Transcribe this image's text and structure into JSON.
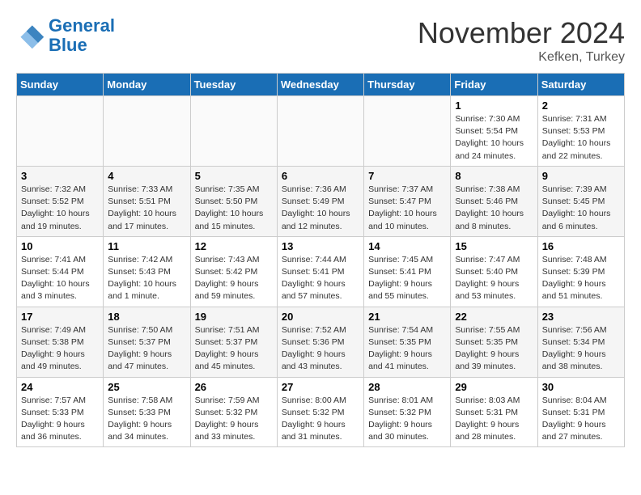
{
  "header": {
    "logo_line1": "General",
    "logo_line2": "Blue",
    "month": "November 2024",
    "location": "Kefken, Turkey"
  },
  "days_of_week": [
    "Sunday",
    "Monday",
    "Tuesday",
    "Wednesday",
    "Thursday",
    "Friday",
    "Saturday"
  ],
  "weeks": [
    [
      {
        "day": "",
        "info": ""
      },
      {
        "day": "",
        "info": ""
      },
      {
        "day": "",
        "info": ""
      },
      {
        "day": "",
        "info": ""
      },
      {
        "day": "",
        "info": ""
      },
      {
        "day": "1",
        "info": "Sunrise: 7:30 AM\nSunset: 5:54 PM\nDaylight: 10 hours and 24 minutes."
      },
      {
        "day": "2",
        "info": "Sunrise: 7:31 AM\nSunset: 5:53 PM\nDaylight: 10 hours and 22 minutes."
      }
    ],
    [
      {
        "day": "3",
        "info": "Sunrise: 7:32 AM\nSunset: 5:52 PM\nDaylight: 10 hours and 19 minutes."
      },
      {
        "day": "4",
        "info": "Sunrise: 7:33 AM\nSunset: 5:51 PM\nDaylight: 10 hours and 17 minutes."
      },
      {
        "day": "5",
        "info": "Sunrise: 7:35 AM\nSunset: 5:50 PM\nDaylight: 10 hours and 15 minutes."
      },
      {
        "day": "6",
        "info": "Sunrise: 7:36 AM\nSunset: 5:49 PM\nDaylight: 10 hours and 12 minutes."
      },
      {
        "day": "7",
        "info": "Sunrise: 7:37 AM\nSunset: 5:47 PM\nDaylight: 10 hours and 10 minutes."
      },
      {
        "day": "8",
        "info": "Sunrise: 7:38 AM\nSunset: 5:46 PM\nDaylight: 10 hours and 8 minutes."
      },
      {
        "day": "9",
        "info": "Sunrise: 7:39 AM\nSunset: 5:45 PM\nDaylight: 10 hours and 6 minutes."
      }
    ],
    [
      {
        "day": "10",
        "info": "Sunrise: 7:41 AM\nSunset: 5:44 PM\nDaylight: 10 hours and 3 minutes."
      },
      {
        "day": "11",
        "info": "Sunrise: 7:42 AM\nSunset: 5:43 PM\nDaylight: 10 hours and 1 minute."
      },
      {
        "day": "12",
        "info": "Sunrise: 7:43 AM\nSunset: 5:42 PM\nDaylight: 9 hours and 59 minutes."
      },
      {
        "day": "13",
        "info": "Sunrise: 7:44 AM\nSunset: 5:41 PM\nDaylight: 9 hours and 57 minutes."
      },
      {
        "day": "14",
        "info": "Sunrise: 7:45 AM\nSunset: 5:41 PM\nDaylight: 9 hours and 55 minutes."
      },
      {
        "day": "15",
        "info": "Sunrise: 7:47 AM\nSunset: 5:40 PM\nDaylight: 9 hours and 53 minutes."
      },
      {
        "day": "16",
        "info": "Sunrise: 7:48 AM\nSunset: 5:39 PM\nDaylight: 9 hours and 51 minutes."
      }
    ],
    [
      {
        "day": "17",
        "info": "Sunrise: 7:49 AM\nSunset: 5:38 PM\nDaylight: 9 hours and 49 minutes."
      },
      {
        "day": "18",
        "info": "Sunrise: 7:50 AM\nSunset: 5:37 PM\nDaylight: 9 hours and 47 minutes."
      },
      {
        "day": "19",
        "info": "Sunrise: 7:51 AM\nSunset: 5:37 PM\nDaylight: 9 hours and 45 minutes."
      },
      {
        "day": "20",
        "info": "Sunrise: 7:52 AM\nSunset: 5:36 PM\nDaylight: 9 hours and 43 minutes."
      },
      {
        "day": "21",
        "info": "Sunrise: 7:54 AM\nSunset: 5:35 PM\nDaylight: 9 hours and 41 minutes."
      },
      {
        "day": "22",
        "info": "Sunrise: 7:55 AM\nSunset: 5:35 PM\nDaylight: 9 hours and 39 minutes."
      },
      {
        "day": "23",
        "info": "Sunrise: 7:56 AM\nSunset: 5:34 PM\nDaylight: 9 hours and 38 minutes."
      }
    ],
    [
      {
        "day": "24",
        "info": "Sunrise: 7:57 AM\nSunset: 5:33 PM\nDaylight: 9 hours and 36 minutes."
      },
      {
        "day": "25",
        "info": "Sunrise: 7:58 AM\nSunset: 5:33 PM\nDaylight: 9 hours and 34 minutes."
      },
      {
        "day": "26",
        "info": "Sunrise: 7:59 AM\nSunset: 5:32 PM\nDaylight: 9 hours and 33 minutes."
      },
      {
        "day": "27",
        "info": "Sunrise: 8:00 AM\nSunset: 5:32 PM\nDaylight: 9 hours and 31 minutes."
      },
      {
        "day": "28",
        "info": "Sunrise: 8:01 AM\nSunset: 5:32 PM\nDaylight: 9 hours and 30 minutes."
      },
      {
        "day": "29",
        "info": "Sunrise: 8:03 AM\nSunset: 5:31 PM\nDaylight: 9 hours and 28 minutes."
      },
      {
        "day": "30",
        "info": "Sunrise: 8:04 AM\nSunset: 5:31 PM\nDaylight: 9 hours and 27 minutes."
      }
    ]
  ]
}
